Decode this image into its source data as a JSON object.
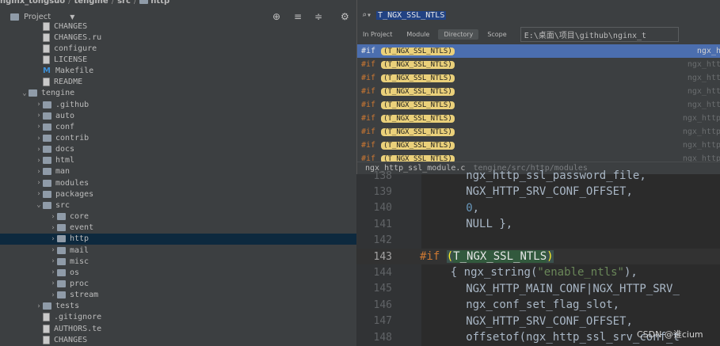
{
  "breadcrumb": [
    "nginx_tongsuo",
    "tengine",
    "src",
    "http"
  ],
  "project_panel": {
    "title": "Project",
    "toolbar_icons": [
      "locate-icon",
      "expand-all-icon",
      "collapse-all-icon",
      "gear-icon"
    ]
  },
  "tree": [
    {
      "label": "CHANGES",
      "type": "file",
      "depth": 2
    },
    {
      "label": "CHANGES.ru",
      "type": "file",
      "depth": 2
    },
    {
      "label": "configure",
      "type": "file",
      "depth": 2
    },
    {
      "label": "LICENSE",
      "type": "file",
      "depth": 2
    },
    {
      "label": "Makefile",
      "type": "mfile",
      "depth": 2
    },
    {
      "label": "README",
      "type": "file",
      "depth": 2
    },
    {
      "label": "tengine",
      "type": "folder",
      "depth": 1,
      "expanded": true
    },
    {
      "label": ".github",
      "type": "folder",
      "depth": 2,
      "expanded": false
    },
    {
      "label": "auto",
      "type": "folder",
      "depth": 2,
      "expanded": false
    },
    {
      "label": "conf",
      "type": "folder",
      "depth": 2,
      "expanded": false
    },
    {
      "label": "contrib",
      "type": "folder",
      "depth": 2,
      "expanded": false
    },
    {
      "label": "docs",
      "type": "folder",
      "depth": 2,
      "expanded": false
    },
    {
      "label": "html",
      "type": "folder",
      "depth": 2,
      "expanded": false
    },
    {
      "label": "man",
      "type": "folder",
      "depth": 2,
      "expanded": false
    },
    {
      "label": "modules",
      "type": "folder",
      "depth": 2,
      "expanded": false
    },
    {
      "label": "packages",
      "type": "folder",
      "depth": 2,
      "expanded": false
    },
    {
      "label": "src",
      "type": "folder",
      "depth": 2,
      "expanded": true
    },
    {
      "label": "core",
      "type": "folder",
      "depth": 3,
      "expanded": false
    },
    {
      "label": "event",
      "type": "folder",
      "depth": 3,
      "expanded": false
    },
    {
      "label": "http",
      "type": "folder",
      "depth": 3,
      "expanded": false,
      "selected": true
    },
    {
      "label": "mail",
      "type": "folder",
      "depth": 3,
      "expanded": false
    },
    {
      "label": "misc",
      "type": "folder",
      "depth": 3,
      "expanded": false
    },
    {
      "label": "os",
      "type": "folder",
      "depth": 3,
      "expanded": false
    },
    {
      "label": "proc",
      "type": "folder",
      "depth": 3,
      "expanded": false
    },
    {
      "label": "stream",
      "type": "folder",
      "depth": 3,
      "expanded": false
    },
    {
      "label": "tests",
      "type": "folder",
      "depth": 2,
      "expanded": false
    },
    {
      "label": ".gitignore",
      "type": "file",
      "depth": 2
    },
    {
      "label": "AUTHORS.te",
      "type": "file",
      "depth": 2
    },
    {
      "label": "CHANGES",
      "type": "file",
      "depth": 2
    }
  ],
  "popup": {
    "query": "T_NGX_SSL_NTLS",
    "filters": [
      "In Project",
      "Module",
      "Directory",
      "Scope"
    ],
    "active_filter": "Directory",
    "path": "E:\\桌面\\项目\\github\\nginx_t",
    "results": [
      {
        "prefix": "#if",
        "match": "(T_NGX_SSL_NTLS)",
        "file": "ngx_h",
        "selected": true
      },
      {
        "prefix": "#if",
        "match": "(T_NGX_SSL_NTLS)",
        "file": "ngx_htt"
      },
      {
        "prefix": "#if",
        "match": "(T_NGX_SSL_NTLS)",
        "file": "ngx_htt"
      },
      {
        "prefix": "#if",
        "match": "(T_NGX_SSL_NTLS)",
        "file": "ngx_htt"
      },
      {
        "prefix": "#if",
        "match": "(T_NGX_SSL_NTLS)",
        "file": "ngx_htt"
      },
      {
        "prefix": "#if",
        "match": "(T_NGX_SSL_NTLS)",
        "file": "ngx_http"
      },
      {
        "prefix": "#if",
        "match": "(T_NGX_SSL_NTLS)",
        "file": "ngx_http"
      },
      {
        "prefix": "#if",
        "match": "(T_NGX_SSL_NTLS)",
        "file": "ngx_http"
      },
      {
        "prefix": "#if",
        "match": "(T_NGX_SSL_NTLS)",
        "file": "ngx_http"
      }
    ],
    "status_file": "ngx_http_ssl_module.c",
    "status_path": "tengine/src/http/modules"
  },
  "editor": {
    "current_line": "143",
    "lines": [
      {
        "n": "138",
        "code": "ngx_http_ssl_password_file,",
        "indent": 3
      },
      {
        "n": "139",
        "code": "NGX_HTTP_SRV_CONF_OFFSET,",
        "indent": 3
      },
      {
        "n": "140",
        "code": "0,",
        "indent": 3,
        "num": true
      },
      {
        "n": "141",
        "code": "NULL },",
        "indent": 3
      },
      {
        "n": "142",
        "code": "",
        "indent": 0
      },
      {
        "n": "143",
        "code": "#if (T_NGX_SSL_NTLS)",
        "indent": 0,
        "directive": true
      },
      {
        "n": "144",
        "code": "{ ngx_string(\"enable_ntls\"),",
        "indent": 2,
        "string": true
      },
      {
        "n": "145",
        "code": "NGX_HTTP_MAIN_CONF|NGX_HTTP_SRV_",
        "indent": 3
      },
      {
        "n": "146",
        "code": "ngx_conf_set_flag_slot,",
        "indent": 3
      },
      {
        "n": "147",
        "code": "NGX_HTTP_SRV_CONF_OFFSET,",
        "indent": 3
      },
      {
        "n": "148",
        "code": "offsetof(ngx_http_ssl_srv_conf_t",
        "indent": 3
      }
    ]
  },
  "watermark": "CSDN @谁cium"
}
